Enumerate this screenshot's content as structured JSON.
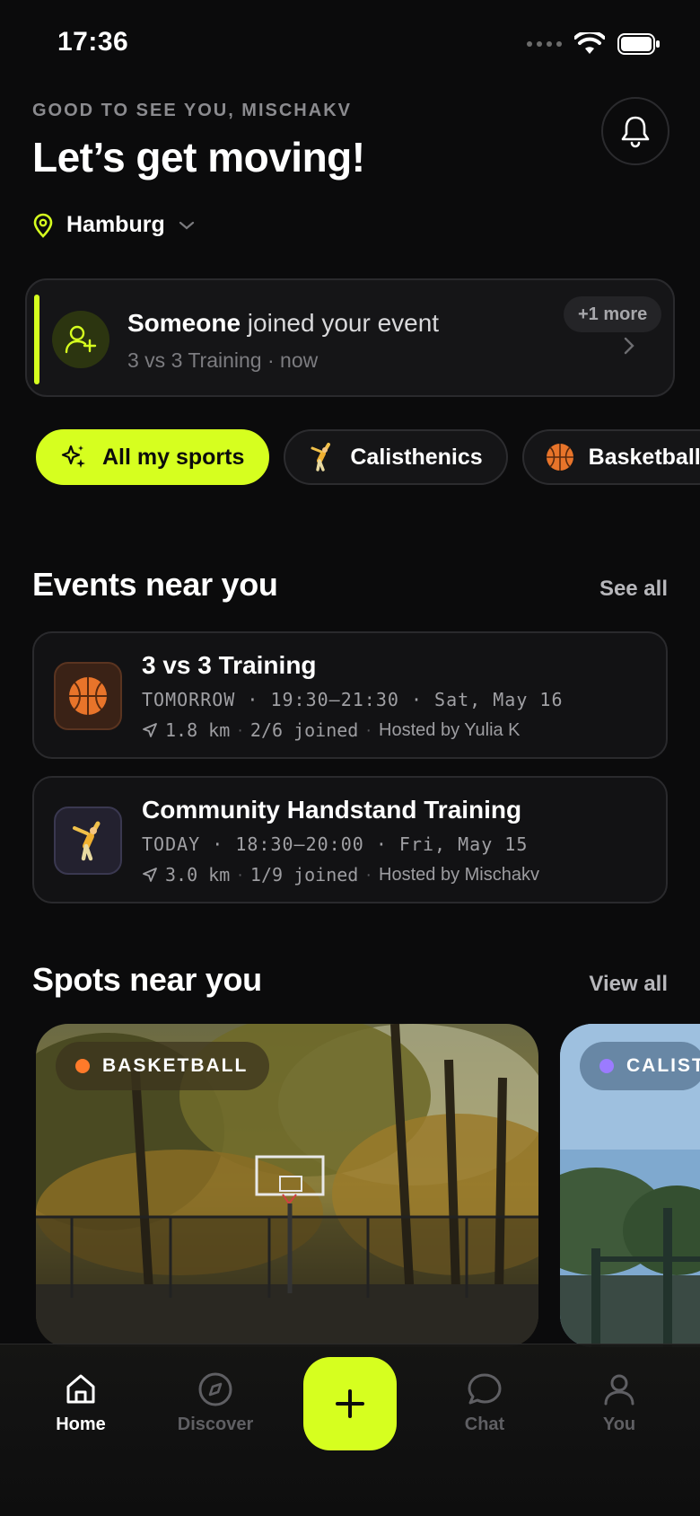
{
  "status": {
    "time": "17:36"
  },
  "header": {
    "greeting": "GOOD TO SEE YOU, MISCHAKV",
    "headline": "Let’s get moving!",
    "city": "Hamburg"
  },
  "notification": {
    "actor": "Someone",
    "action": " joined your event",
    "event": "3 vs 3 Training",
    "time": "now",
    "more": "+1 more"
  },
  "chips": [
    {
      "label": "All my sports",
      "icon": "sparkles-icon",
      "active": true
    },
    {
      "label": "Calisthenics",
      "icon": "handstand-emoji",
      "active": false
    },
    {
      "label": "Basketball",
      "icon": "basketball-emoji",
      "active": false
    }
  ],
  "events_section": {
    "title": "Events near you",
    "link": "See all"
  },
  "events": [
    {
      "title": "3 vs 3 Training",
      "day": "TOMORROW",
      "time": "19:30–21:30",
      "date": "Sat, May 16",
      "distance": "1.8 km",
      "joined": "2/6 joined",
      "host": "Hosted by Yulia K",
      "sport": "basketball"
    },
    {
      "title": "Community Handstand Training",
      "day": "TODAY",
      "time": "18:30–20:00",
      "date": "Fri, May 15",
      "distance": "3.0 km",
      "joined": "1/9 joined",
      "host": "Hosted by Mischakv",
      "sport": "calisthenics"
    }
  ],
  "spots_section": {
    "title": "Spots near you",
    "link": "View all"
  },
  "spots": [
    {
      "tag": "BASKETBALL",
      "dot_color": "#ff7a2a"
    },
    {
      "tag": "CALIST",
      "dot_color": "#9b7bff"
    }
  ],
  "tabs": [
    {
      "label": "Home",
      "icon": "home-icon",
      "active": true
    },
    {
      "label": "Discover",
      "icon": "compass-icon",
      "active": false
    },
    {
      "label": "Chat",
      "icon": "chat-icon",
      "active": false
    },
    {
      "label": "You",
      "icon": "person-icon",
      "active": false
    }
  ],
  "colors": {
    "accent": "#d6ff1f",
    "background": "#0b0b0c"
  }
}
